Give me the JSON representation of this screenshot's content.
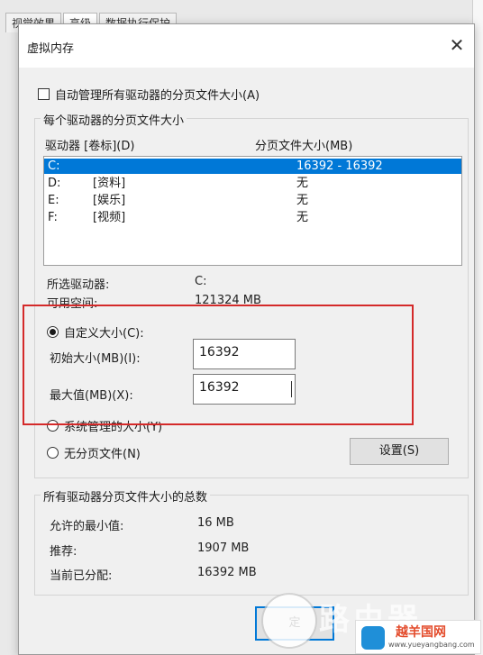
{
  "background": {
    "tabs": [
      {
        "label": "视觉效果"
      },
      {
        "label": "高级"
      },
      {
        "label": "数据执行保护"
      }
    ]
  },
  "dialog": {
    "title": "虚拟内存",
    "close_glyph": "✕",
    "auto_manage_label": "自动管理所有驱动器的分页文件大小(A)",
    "group_title": "每个驱动器的分页文件大小",
    "list_headers": {
      "drive": "驱动器 [卷标](D)",
      "size": "分页文件大小(MB)"
    },
    "drives": [
      {
        "letter": "C:",
        "label": "",
        "size": "16392 - 16392",
        "selected": true
      },
      {
        "letter": "D:",
        "label": "[资料]",
        "size": "无",
        "selected": false
      },
      {
        "letter": "E:",
        "label": "[娱乐]",
        "size": "无",
        "selected": false
      },
      {
        "letter": "F:",
        "label": "[视频]",
        "size": "无",
        "selected": false
      }
    ],
    "selected_drive_label": "所选驱动器:",
    "selected_drive_value": "C:",
    "available_space_label": "可用空间:",
    "available_space_value": "121324 MB",
    "custom_size_label": "自定义大小(C):",
    "initial_size_label": "初始大小(MB)(I):",
    "initial_size_value": "16392",
    "max_size_label": "最大值(MB)(X):",
    "max_size_value": "16392",
    "system_managed_label": "系统管理的大小(Y)",
    "no_paging_label": "无分页文件(N)",
    "set_button": "设置(S)",
    "totals_group_title": "所有驱动器分页文件大小的总数",
    "min_allowed_label": "允许的最小值:",
    "min_allowed_value": "16 MB",
    "recommended_label": "推荐:",
    "recommended_value": "1907 MB",
    "current_allocated_label": "当前已分配:",
    "current_allocated_value": "16392 MB",
    "ok_button_partial": "定"
  },
  "watermark": {
    "text": "路由器",
    "brand_name": "越羊国网",
    "brand_url": "www.yueyangbang.com"
  },
  "colors": {
    "selection": "#0078d7",
    "highlight_box": "#d42a2a"
  }
}
